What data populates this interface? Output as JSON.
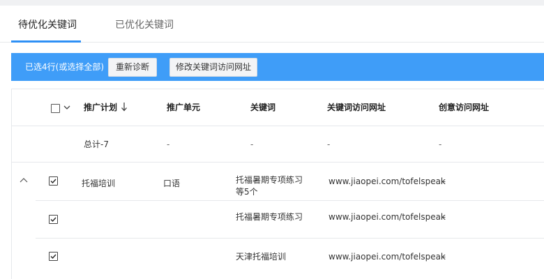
{
  "tabs": [
    {
      "label": "待优化关键词",
      "active": true
    },
    {
      "label": "已优化关键词",
      "active": false
    }
  ],
  "action_bar": {
    "selected_text": "已选4行(或选择全部)",
    "rediagnose_label": "重新诊断",
    "modify_url_label": "修改关键词访问网址"
  },
  "table": {
    "headers": {
      "plan": "推广计划",
      "unit": "推广单元",
      "keyword": "关键词",
      "keyword_url": "关键词访问网址",
      "idea_url": "创意访问网址"
    },
    "sort_icon": "arrow-down-icon",
    "total_row": {
      "plan": "总计-7",
      "unit": "-",
      "keyword": "-",
      "keyword_url": "-",
      "idea_url": "-"
    },
    "rows": [
      {
        "checked": true,
        "plan": "托福培训",
        "unit": "口语",
        "keyword_line1": "托福暑期专项练习",
        "keyword_line2": "等5个",
        "keyword_url": "www.jiaopei.com/tofelspeak",
        "idea_url": "–"
      },
      {
        "checked": true,
        "plan": "",
        "unit": "",
        "keyword": "托福暑期专项练习",
        "keyword_url": "www.jiaopei.com/tofelspeak",
        "idea_url": "–"
      },
      {
        "checked": true,
        "plan": "",
        "unit": "",
        "keyword": "天津托福培训",
        "keyword_url": "www.jiaopei.com/tofelspeak",
        "idea_url": "–"
      }
    ]
  },
  "colors": {
    "accent": "#3f9df8",
    "tab_underline": "#2e90f5",
    "border": "#e6e8eb"
  }
}
